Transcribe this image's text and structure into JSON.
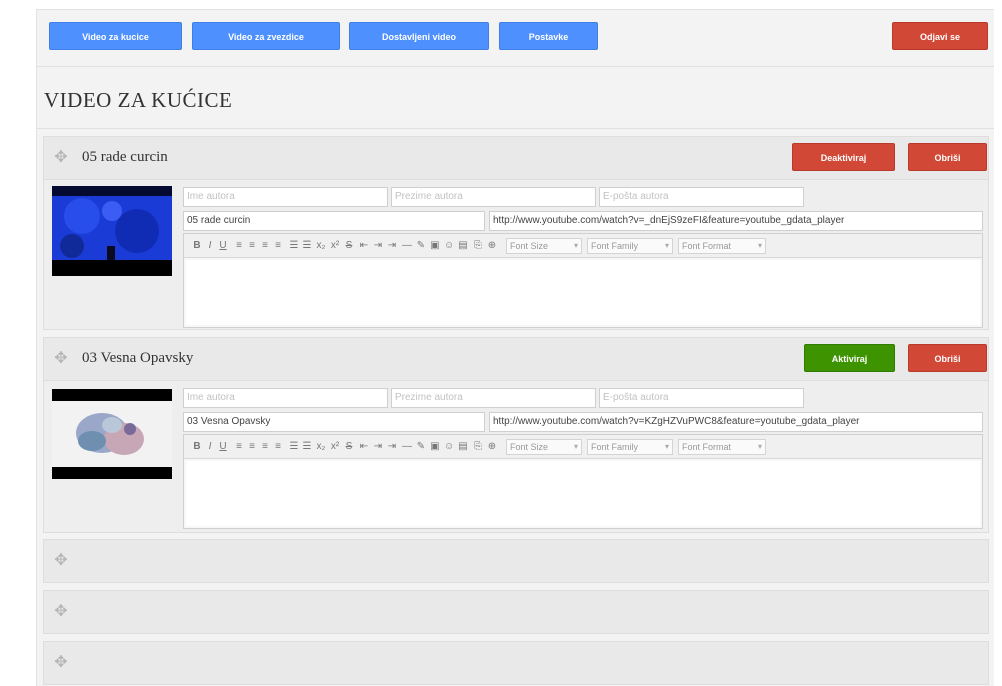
{
  "topbar": {
    "buttons": [
      "Video za kucice",
      "Video za zvezdice",
      "Dostavljeni video",
      "Postavke"
    ],
    "logout": "Odjavi se"
  },
  "page_title": "VIDEO ZA KUĆICE",
  "videos": [
    {
      "title": "05 rade curcin",
      "status_button": "Deaktiviraj",
      "delete_button": "Obriši",
      "author_first_placeholder": "Ime autora",
      "author_last_placeholder": "Prezime autora",
      "author_email_placeholder": "E-pošta autora",
      "name_value": "05 rade curcin",
      "url_value": "http://www.youtube.com/watch?v=_dnEjS9zeFI&feature=youtube_gdata_player"
    },
    {
      "title": "03 Vesna Opavsky",
      "status_button": "Aktiviraj",
      "delete_button": "Obriši",
      "author_first_placeholder": "Ime autora",
      "author_last_placeholder": "Prezime autora",
      "author_email_placeholder": "E-pošta autora",
      "name_value": "03 Vesna Opavsky",
      "url_value": "http://www.youtube.com/watch?v=KZgHZVuPWC8&feature=youtube_gdata_player"
    }
  ],
  "editor": {
    "font_size": "Font Size",
    "font_family": "Font Family",
    "font_format": "Font Format",
    "tools": [
      "B",
      "I",
      "U",
      "≡",
      "≡",
      "≡",
      "≡",
      "☰",
      "☰",
      "x₂",
      "x²",
      "S",
      "⇤",
      "⇥",
      "⇥",
      "—",
      "✎",
      "▣",
      "☺",
      "▤",
      "⎘",
      "⊕"
    ]
  },
  "colors": {
    "blue": "#4d90fe",
    "red": "#d14836",
    "green": "#3d9400"
  }
}
